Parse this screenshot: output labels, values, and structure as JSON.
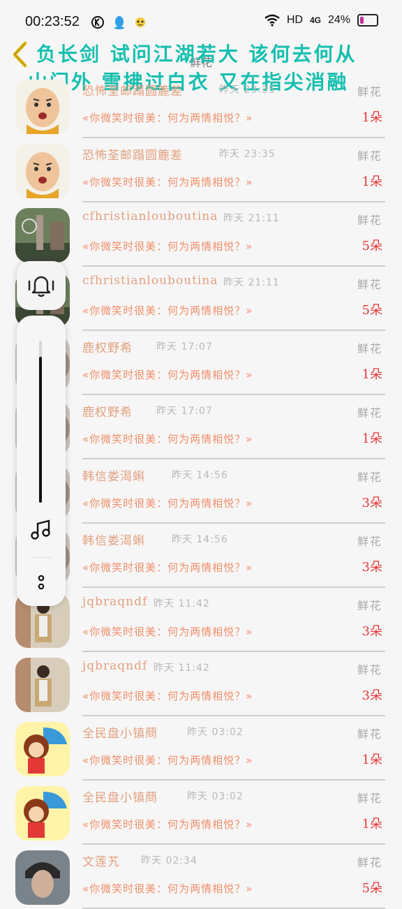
{
  "status_bar": {
    "time": "00:23:52",
    "network": "HD",
    "signal": "4G",
    "battery": "24%",
    "battery_level": 0.24
  },
  "header": {
    "title": "鲜花"
  },
  "marquee": {
    "line1": "负长剑 试问江湖若大 该何去何从",
    "line2": "山门外 雪拂过白衣 又在指尖消融"
  },
  "rows": [
    {
      "name": "恐怖荃邮蹋圆簏差",
      "time": "昨天 23:35",
      "type": "鲜花",
      "message": "«你微笑时很美：何为两情相悦？»",
      "count": "1朵"
    },
    {
      "name": "恐怖荃邮蹋圆簏差",
      "time": "昨天 23:35",
      "type": "鲜花",
      "message": "«你微笑时很美：何为两情相悦？»",
      "count": "1朵"
    },
    {
      "name": "cfhristianlouboutina",
      "time": "昨天 21:11",
      "type": "鲜花",
      "message": "«你微笑时很美：何为两情相悦？»",
      "count": "5朵"
    },
    {
      "name": "cfhristianlouboutina",
      "time": "昨天 21:11",
      "type": "鲜花",
      "message": "«你微笑时很美：何为两情相悦？»",
      "count": "5朵"
    },
    {
      "name": "鹿权野希",
      "time": "昨天 17:07",
      "type": "鲜花",
      "message": "«你微笑时很美：何为两情相悦？»",
      "count": "1朵"
    },
    {
      "name": "鹿权野希",
      "time": "昨天 17:07",
      "type": "鲜花",
      "message": "«你微笑时很美：何为两情相悦？»",
      "count": "1朵"
    },
    {
      "name": "韩信娄渴蝌",
      "time": "昨天 14:56",
      "type": "鲜花",
      "message": "«你微笑时很美：何为两情相悦？»",
      "count": "3朵"
    },
    {
      "name": "韩信娄渴蝌",
      "time": "昨天 14:56",
      "type": "鲜花",
      "message": "«你微笑时很美：何为两情相悦？»",
      "count": "3朵"
    },
    {
      "name": "jqbraqndf",
      "time": "昨天 11:42",
      "type": "鲜花",
      "message": "«你微笑时很美：何为两情相悦？»",
      "count": "3朵"
    },
    {
      "name": "jqbraqndf",
      "time": "昨天 11:42",
      "type": "鲜花",
      "message": "«你微笑时很美：何为两情相悦？»",
      "count": "3朵"
    },
    {
      "name": "全民盘小镇蔄",
      "time": "昨天 03:02",
      "type": "鲜花",
      "message": "«你微笑时很美：何为两情相悦？»",
      "count": "1朵"
    },
    {
      "name": "全民盘小镇蔄",
      "time": "昨天 03:02",
      "type": "鲜花",
      "message": "«你微笑时很美：何为两情相悦？»",
      "count": "1朵"
    },
    {
      "name": "文莲艽",
      "time": "昨天 02:34",
      "type": "鲜花",
      "message": "«你微笑时很美：何为两情相悦？»",
      "count": "5朵"
    }
  ],
  "avatars": [
    "cartoon-man",
    "cartoon-man",
    "cityscape",
    "cityscape",
    "blurred",
    "blurred",
    "blurred",
    "blurred",
    "man-photo",
    "man-photo",
    "umbrella-girl",
    "umbrella-girl",
    "portrait"
  ],
  "volume": {
    "level": 0.9
  }
}
